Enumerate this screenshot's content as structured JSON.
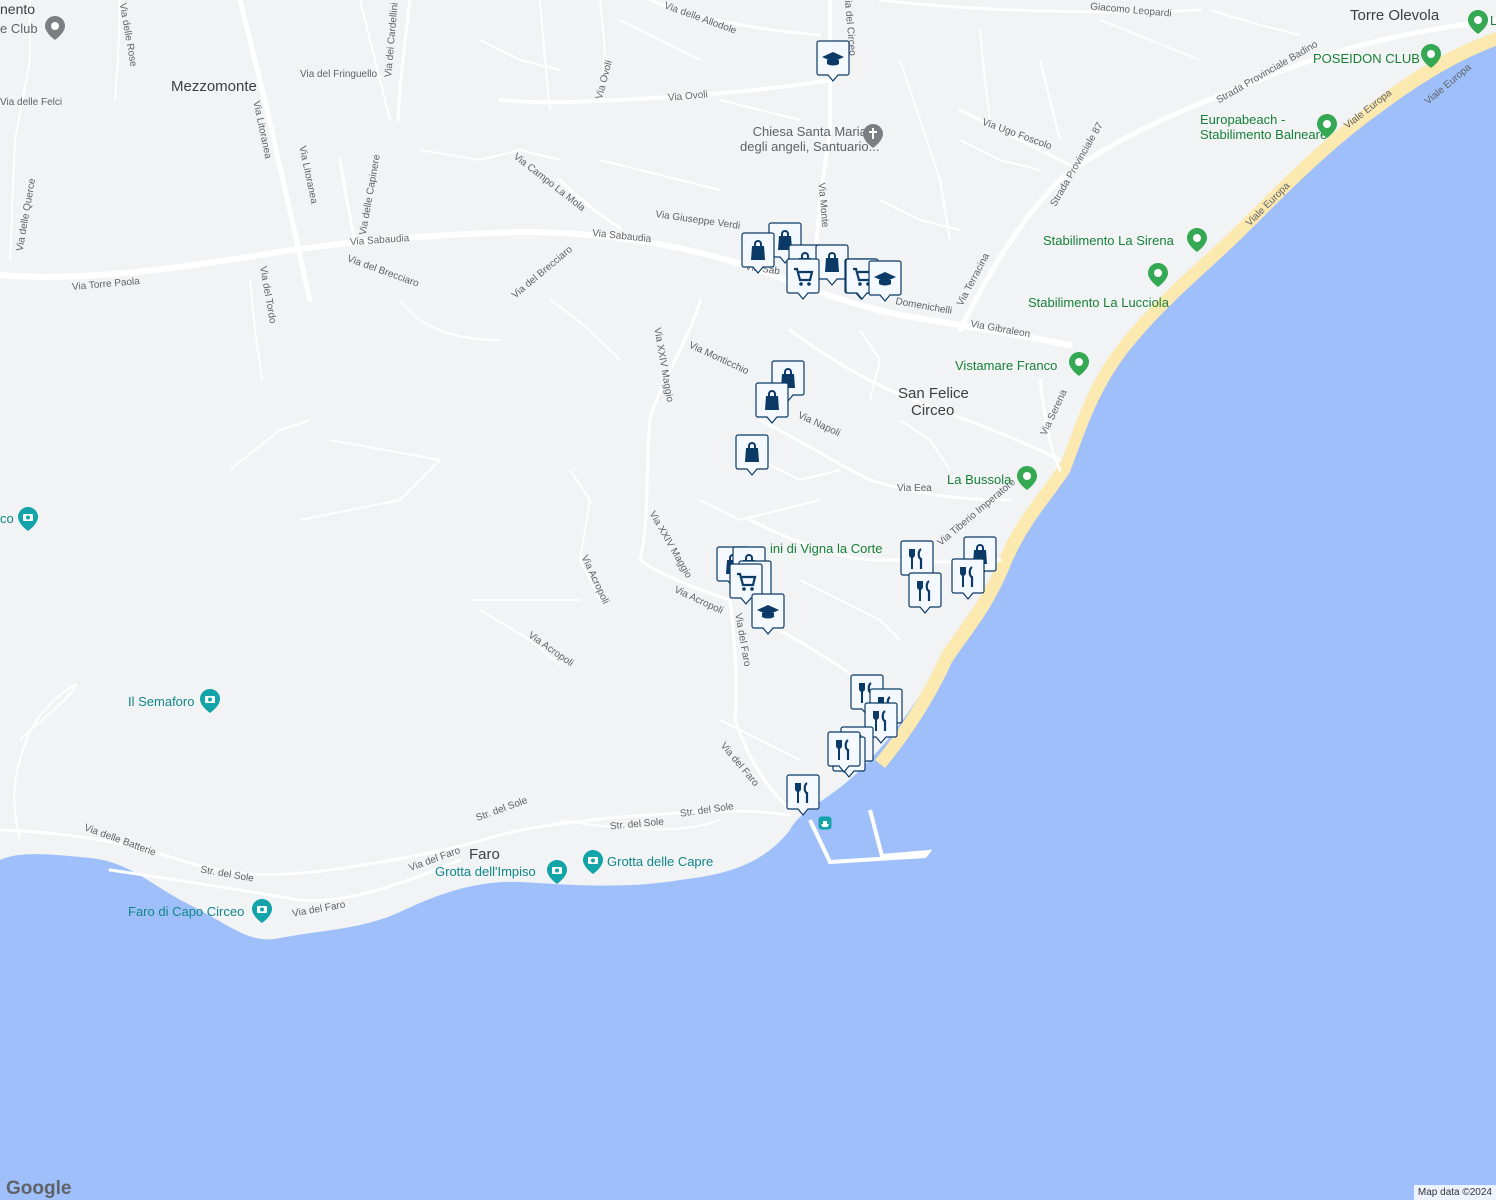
{
  "map": {
    "attribution": "Map data ©2024",
    "logo": "Google",
    "colors": {
      "land": "#f1f3f4",
      "sea": "#9ebff9",
      "road": "#ffffff",
      "beach": "#fbe9b0",
      "pin": "#0b3a66",
      "green_poi": "#34a853",
      "teal_poi": "#12a4a8"
    }
  },
  "labels": {
    "towns": [
      {
        "id": "mezzomonte",
        "text": "Mezzomonte"
      },
      {
        "id": "san-felice",
        "text": "San Felice"
      },
      {
        "id": "circeo",
        "text": "Circeo"
      },
      {
        "id": "torre-olevola",
        "text": "Torre Olevola"
      },
      {
        "id": "faro",
        "text": "Faro"
      },
      {
        "id": "nento",
        "text": "nento"
      }
    ],
    "streets": [
      "Via Torre Paola",
      "Via Sabaudia",
      "Via Sabaudia",
      "Via Litoranea",
      "Via Litoranea",
      "Via del Brecciaro",
      "Via del Brecciaro",
      "Via del Tordo",
      "Via delle Querce",
      "Via delle Felci",
      "Via del Fringuello",
      "Via dei Cardellini",
      "Via delle Rose",
      "Via delle Capinere",
      "Via Campo La Mola",
      "Via Giuseppe Verdi",
      "Via Ovoli",
      "Via Ovoli",
      "Via delle Allodole",
      "Via Monticchio",
      "Via XXIV Maggio",
      "Via XXIV Maggio",
      "Via Acropoli",
      "Via Acropoli",
      "Via Acropoli",
      "Via del Faro",
      "Via del Faro",
      "Via del Faro",
      "Via del Faro",
      "Str. del Sole",
      "Str. del Sole",
      "Str. del Sole",
      "Str. del Sole",
      "Via delle Batterie",
      "Via Napoli",
      "Via Eea",
      "Via Tiberio Imperatore",
      "Via Gibraleon",
      "Via Terracina",
      "Strada Provinciale 87",
      "Strada Provinciale Badino",
      "Via Ugo Foscolo",
      "Giacomo Leopardi",
      "Viale Europa",
      "Viale Europa",
      "Viale Europa",
      "Via Serena",
      "Domenichelli",
      "Via Monte",
      "Via del Circeo",
      "Via Sab"
    ],
    "pois": [
      {
        "id": "chiesa",
        "text": "Chiesa Santa Maria\ndegli angeli, Santuario...",
        "kind": "gray",
        "icon": "church-icon"
      },
      {
        "id": "poseidon",
        "text": "POSEIDON CLUB",
        "kind": "green",
        "icon": "pin-icon"
      },
      {
        "id": "europabeach",
        "text": "Europabeach -\nStabilimento Balneare",
        "kind": "green",
        "icon": "pin-icon"
      },
      {
        "id": "sirena",
        "text": "Stabilimento La Sirena",
        "kind": "green",
        "icon": "pin-icon"
      },
      {
        "id": "lucciola",
        "text": "Stabilimento La Lucciola",
        "kind": "green",
        "icon": "pin-icon"
      },
      {
        "id": "vistamare",
        "text": "Vistamare Franco",
        "kind": "green",
        "icon": "pin-icon"
      },
      {
        "id": "bussola",
        "text": "La Bussola",
        "kind": "green",
        "icon": "pin-icon"
      },
      {
        "id": "giardini",
        "text": "ini di Vigna la Corte",
        "kind": "green",
        "icon": ""
      },
      {
        "id": "semaforo",
        "text": "Il Semaforo",
        "kind": "teal",
        "icon": "camera-icon"
      },
      {
        "id": "faro-capo",
        "text": "Faro di Capo Circeo",
        "kind": "teal",
        "icon": "camera-icon"
      },
      {
        "id": "grotta-impiso",
        "text": "Grotta dell'Impiso",
        "kind": "teal",
        "icon": "camera-icon"
      },
      {
        "id": "grotta-capre",
        "text": "Grotta delle Capre",
        "kind": "teal",
        "icon": "camera-icon"
      },
      {
        "id": "club-nw",
        "text": "e Club",
        "kind": "gray",
        "icon": "pin-icon"
      },
      {
        "id": "co",
        "text": "co",
        "kind": "teal",
        "icon": "camera-icon"
      },
      {
        "id": "l-ne",
        "text": "L",
        "kind": "green",
        "icon": "pin-icon"
      }
    ]
  },
  "markers": [
    {
      "type": "school"
    },
    {
      "type": "shopping"
    },
    {
      "type": "shopping"
    },
    {
      "type": "shopping"
    },
    {
      "type": "shopping"
    },
    {
      "type": "grocery"
    },
    {
      "type": "grocery"
    },
    {
      "type": "shopping"
    },
    {
      "type": "grocery"
    },
    {
      "type": "school"
    },
    {
      "type": "shopping"
    },
    {
      "type": "shopping"
    },
    {
      "type": "shopping"
    },
    {
      "type": "shopping"
    },
    {
      "type": "shopping"
    },
    {
      "type": "grocery"
    },
    {
      "type": "school"
    },
    {
      "type": "restaurant"
    },
    {
      "type": "restaurant"
    },
    {
      "type": "shopping"
    },
    {
      "type": "restaurant"
    },
    {
      "type": "restaurant"
    },
    {
      "type": "restaurant"
    },
    {
      "type": "restaurant"
    },
    {
      "type": "restaurant"
    },
    {
      "type": "restaurant"
    },
    {
      "type": "restaurant"
    },
    {
      "type": "restaurant"
    },
    {
      "type": "ferry"
    }
  ]
}
